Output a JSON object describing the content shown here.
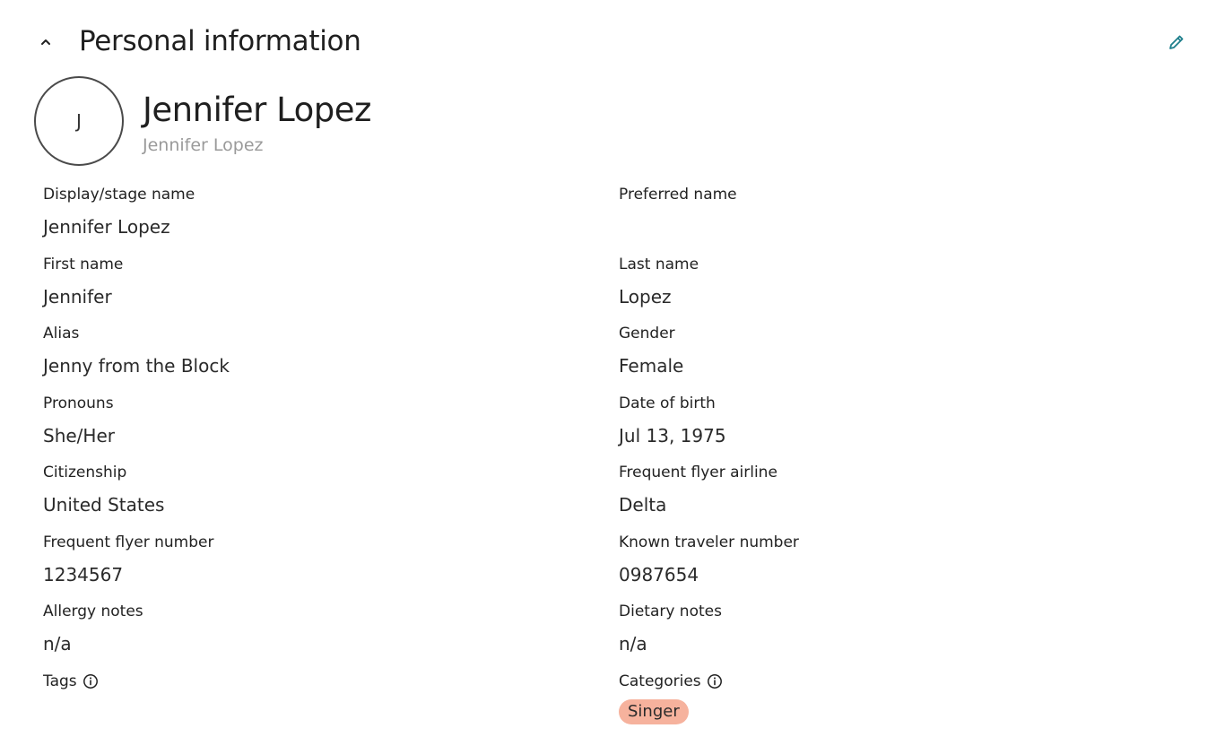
{
  "section": {
    "title": "Personal information"
  },
  "profile": {
    "avatar_initial": "J",
    "name": "Jennifer Lopez",
    "subname": "Jennifer Lopez"
  },
  "fields": {
    "display_stage_name": {
      "label": "Display/stage name",
      "value": "Jennifer Lopez"
    },
    "preferred_name": {
      "label": "Preferred name",
      "value": ""
    },
    "first_name": {
      "label": "First name",
      "value": "Jennifer"
    },
    "last_name": {
      "label": "Last name",
      "value": "Lopez"
    },
    "alias": {
      "label": "Alias",
      "value": "Jenny from the Block"
    },
    "gender": {
      "label": "Gender",
      "value": "Female"
    },
    "pronouns": {
      "label": "Pronouns",
      "value": "She/Her"
    },
    "date_of_birth": {
      "label": "Date of birth",
      "value": "Jul 13, 1975"
    },
    "citizenship": {
      "label": "Citizenship",
      "value": "United States"
    },
    "frequent_flyer_airline": {
      "label": "Frequent flyer airline",
      "value": "Delta"
    },
    "frequent_flyer_number": {
      "label": "Frequent flyer number",
      "value": "1234567"
    },
    "known_traveler_number": {
      "label": "Known traveler number",
      "value": "0987654"
    },
    "allergy_notes": {
      "label": "Allergy notes",
      "value": "n/a"
    },
    "dietary_notes": {
      "label": "Dietary notes",
      "value": "n/a"
    },
    "tags": {
      "label": "Tags",
      "items": []
    },
    "categories": {
      "label": "Categories",
      "items": [
        "Singer"
      ]
    }
  },
  "icons": {
    "collapse": "chevron-up-icon",
    "edit": "pencil-icon",
    "info": "info-icon"
  },
  "colors": {
    "accent": "#1e7f8c",
    "chip_bg": "#f6b29d",
    "muted_text": "#9a9a9a"
  }
}
